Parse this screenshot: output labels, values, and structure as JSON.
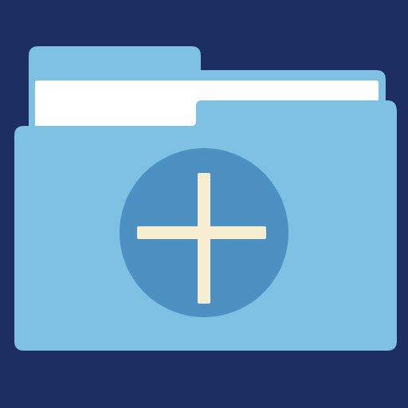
{
  "icon": {
    "name": "add-folder-icon"
  },
  "colors": {
    "background": "#1d2f62",
    "folder_back": "#7ec1e2",
    "paper": "#ffffff",
    "folder_front": "#7ec1e2",
    "circle": "#4d91c3",
    "plus": "#f7edd0"
  }
}
